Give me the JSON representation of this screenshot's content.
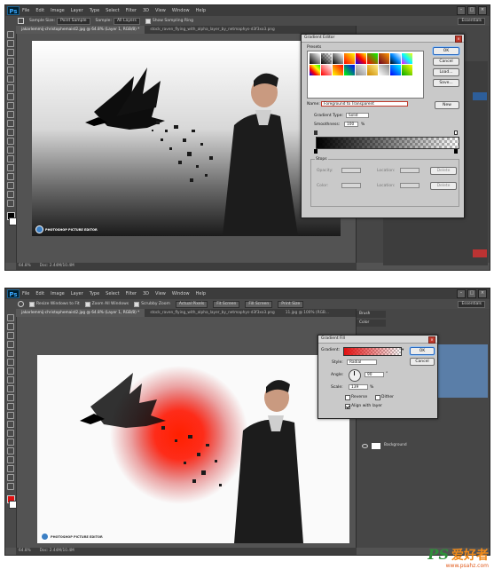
{
  "colors": {
    "ps_accent": "#3aa7ff",
    "dialog_ok": "#2a6ac0",
    "brand_green": "#2f8f3a",
    "brand_orange": "#f08a1a"
  },
  "top": {
    "app_logo": "Ps",
    "menu": [
      "File",
      "Edit",
      "Image",
      "Layer",
      "Type",
      "Select",
      "Filter",
      "3D",
      "View",
      "Window",
      "Help"
    ],
    "window_controls": [
      "–",
      "□",
      "×"
    ],
    "options": {
      "sample_size_label": "Sample Size:",
      "sample_size_value": "Point Sample",
      "sample_label": "Sample:",
      "sample_value": "All Layers",
      "show_ring": "Show Sampling Ring",
      "workspace": "Essentials"
    },
    "tabs": [
      "jakarlemmij-christophemaist2.jpg @ 64.8% (Layer 1, RGB/8) *",
      "stock_raven_flying_with_alpha_layer_by_netmaphys-d3f3xo3.png"
    ],
    "status": {
      "zoom": "64.8%",
      "doc": "Doc: 2.44M/10.4M"
    },
    "watermark": "PHOTOSHOP PICTURE EDITOR",
    "dialog": {
      "title": "Gradient Editor",
      "presets_label": "Presets",
      "ok": "OK",
      "cancel": "Cancel",
      "load": "Load...",
      "save": "Save...",
      "name_label": "Name:",
      "name_value": "Foreground to Transparent",
      "new": "New",
      "gradient_type_label": "Gradient Type:",
      "gradient_type_value": "Solid",
      "smoothness_label": "Smoothness:",
      "smoothness_value": "100",
      "percent": "%",
      "stops_label": "Stops",
      "opacity_label": "Opacity:",
      "color_label": "Color:",
      "location_label": "Location:",
      "delete": "Delete"
    }
  },
  "bottom": {
    "app_logo": "Ps",
    "menu": [
      "File",
      "Edit",
      "Image",
      "Layer",
      "Type",
      "Select",
      "Filter",
      "3D",
      "View",
      "Window",
      "Help"
    ],
    "window_controls": [
      "–",
      "□",
      "×"
    ],
    "options": {
      "resize_windows": "Resize Windows to Fit",
      "zoom_all": "Zoom All Windows",
      "scrubby_zoom": "Scrubby Zoom",
      "actual_pixels": "Actual Pixels",
      "fit_screen": "Fit Screen",
      "fill_screen": "Fill Screen",
      "print_size": "Print Size",
      "workspace": "Essentials"
    },
    "tabs": [
      "jakarlemmij-christophemaist2.jpg @ 64.8% (Layer 1, RGB/8) *",
      "stock_raven_flying_with_alpha_layer_by_netmaphys-d3f3xo3.png",
      "11.jpg @ 100% (RGB..."
    ],
    "panel_tabs": [
      "Brush",
      "Color"
    ],
    "layers": [
      {
        "name": "Background"
      }
    ],
    "status": {
      "zoom": "64.8%",
      "doc": "Doc: 2.44M/10.4M"
    },
    "watermark": "PHOTOSHOP PICTURE EDITOR",
    "dialog": {
      "title": "Gradient Fill",
      "gradient_label": "Gradient:",
      "style_label": "Style:",
      "style_value": "Radial",
      "angle_label": "Angle:",
      "angle_value": "90",
      "degree": "°",
      "scale_label": "Scale:",
      "scale_value": "139",
      "percent": "%",
      "reverse": "Reverse",
      "dither": "Dither",
      "align": "Align with layer",
      "ok": "OK",
      "cancel": "Cancel"
    }
  },
  "brand": {
    "ps": "PS",
    "cn": "爱好者",
    "url": "www.psahz.com"
  }
}
